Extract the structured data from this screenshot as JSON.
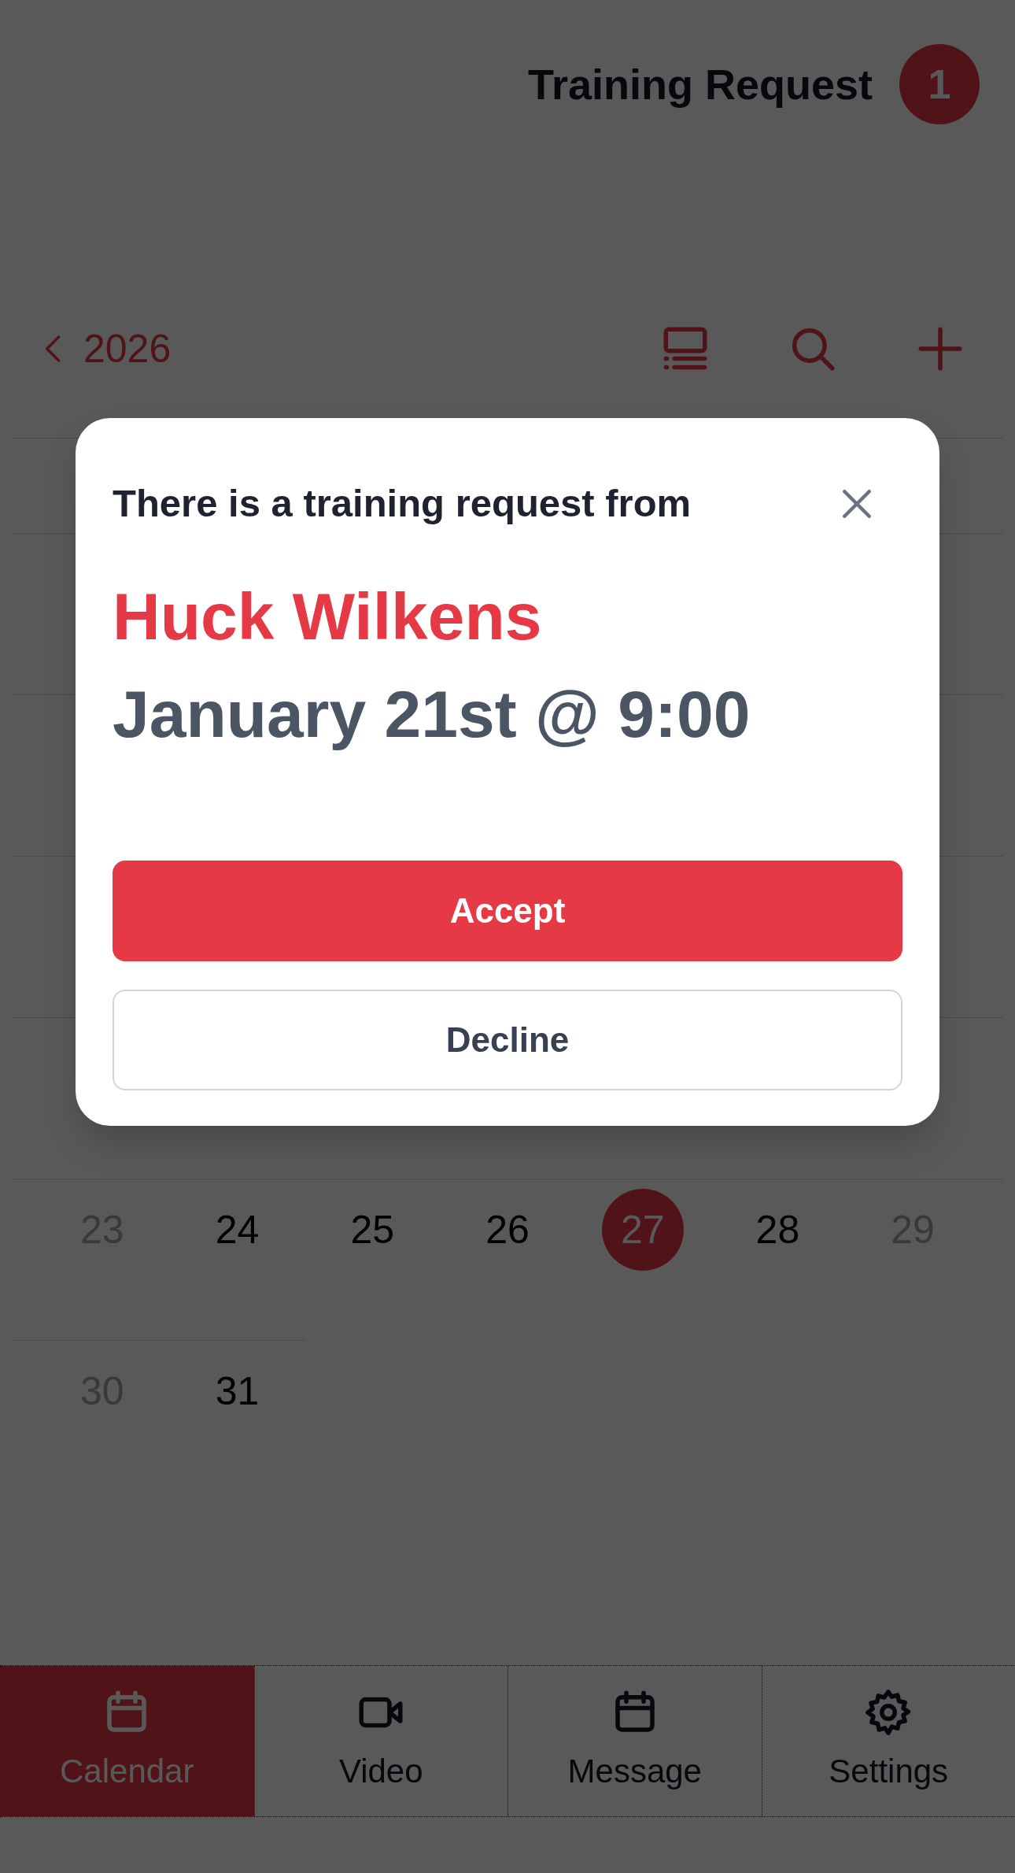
{
  "header": {
    "title": "Training Request",
    "badge": "1"
  },
  "calendar": {
    "year": "2026",
    "weeks": [
      {
        "days": [
          {
            "label": "23",
            "weekend": true,
            "today": false
          },
          {
            "label": "24",
            "weekend": false,
            "today": false
          },
          {
            "label": "25",
            "weekend": false,
            "today": false
          },
          {
            "label": "26",
            "weekend": false,
            "today": false
          },
          {
            "label": "27",
            "weekend": false,
            "today": true
          },
          {
            "label": "28",
            "weekend": false,
            "today": false
          },
          {
            "label": "29",
            "weekend": true,
            "today": false
          }
        ]
      },
      {
        "days": [
          {
            "label": "30",
            "weekend": true,
            "today": false
          },
          {
            "label": "31",
            "weekend": false,
            "today": false
          }
        ]
      }
    ]
  },
  "nav": [
    {
      "label": "Calendar",
      "selected": true
    },
    {
      "label": "Video",
      "selected": false
    },
    {
      "label": "Message",
      "selected": false
    },
    {
      "label": "Settings",
      "selected": false
    }
  ],
  "modal": {
    "intro": "There is a training request from",
    "name": "Huck Wilkens",
    "when": "January 21st @ 9:00",
    "buttons": [
      {
        "label": "Accept",
        "kind": "primary"
      },
      {
        "label": "Decline",
        "kind": "secondary"
      }
    ]
  }
}
